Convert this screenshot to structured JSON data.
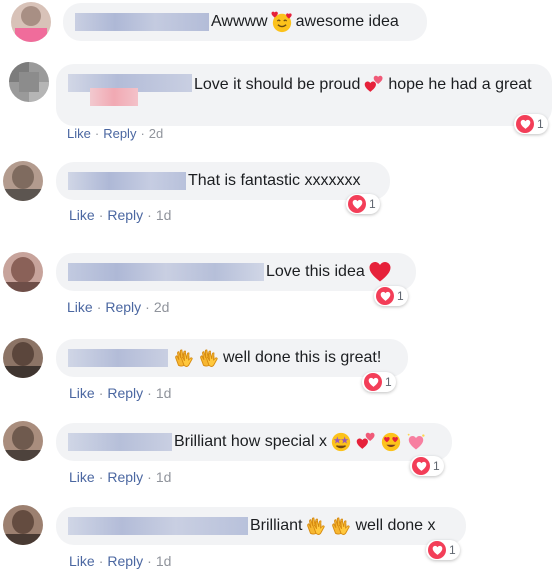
{
  "comments": [
    {
      "text_before": "Awwww",
      "text_after": "awesome idea",
      "emojis_icon": "smiling-face-with-hearts-icon",
      "like_label": "",
      "reply_label": "",
      "time": "",
      "reaction_count": ""
    },
    {
      "text_before": "Love it should be proud",
      "text_after": "hope he had a great",
      "emojis_icon": "two-hearts-icon",
      "like_label": "Like",
      "reply_label": "Reply",
      "time": "2d",
      "reaction_count": "1"
    },
    {
      "text_before": "That is fantastic xxxxxxx",
      "like_label": "Like",
      "reply_label": "Reply",
      "time": "1d",
      "reaction_count": "1"
    },
    {
      "text_before": "Love this idea",
      "emojis_icon": "red-heart-icon",
      "like_label": "Like",
      "reply_label": "Reply",
      "time": "2d",
      "reaction_count": "1"
    },
    {
      "text_after": "well done this is great!",
      "emojis_icon": "clapping-hands-icon",
      "like_label": "Like",
      "reply_label": "Reply",
      "time": "1d",
      "reaction_count": "1"
    },
    {
      "text_before": "Brilliant how special x",
      "emojis_icon": "star-struck-two-hearts-heart-eyes-sparkling-heart-icons",
      "like_label": "Like",
      "reply_label": "Reply",
      "time": "1d",
      "reaction_count": "1"
    },
    {
      "text_before": "Brilliant",
      "text_after": "well done x",
      "emojis_icon": "clapping-hands-icon",
      "like_label": "Like",
      "reply_label": "Reply",
      "time": "1d",
      "reaction_count": "1"
    }
  ],
  "colors": {
    "bubble": "#f2f3f5",
    "link": "#4b67a1",
    "meta": "#90949c",
    "love_reaction": "#f33e58"
  }
}
